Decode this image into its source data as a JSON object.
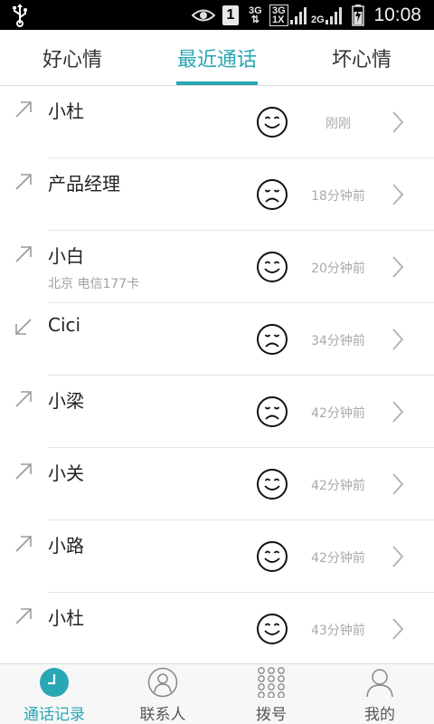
{
  "status_bar": {
    "network_a": "3G",
    "network_b_top": "3G",
    "network_b_bottom": "1X",
    "network_c": "2G",
    "sim_number": "1",
    "time": "10:08"
  },
  "tabs": [
    {
      "label": "好心情",
      "active": false
    },
    {
      "label": "最近通话",
      "active": true
    },
    {
      "label": "坏心情",
      "active": false
    }
  ],
  "calls": [
    {
      "name": "小杜",
      "subtitle": "",
      "mood": "happy",
      "direction": "outgoing",
      "time": "刚刚"
    },
    {
      "name": "产品经理",
      "subtitle": "",
      "mood": "sad",
      "direction": "outgoing",
      "time": "18分钟前"
    },
    {
      "name": "小白",
      "subtitle": "北京  电信177卡",
      "mood": "happy",
      "direction": "outgoing",
      "time": "20分钟前"
    },
    {
      "name": "Cici",
      "subtitle": "",
      "mood": "sad",
      "direction": "incoming",
      "time": "34分钟前"
    },
    {
      "name": "小梁",
      "subtitle": "",
      "mood": "sad",
      "direction": "outgoing",
      "time": "42分钟前"
    },
    {
      "name": "小关",
      "subtitle": "",
      "mood": "happy",
      "direction": "outgoing",
      "time": "42分钟前"
    },
    {
      "name": "小路",
      "subtitle": "",
      "mood": "happy",
      "direction": "outgoing",
      "time": "42分钟前"
    },
    {
      "name": "小杜",
      "subtitle": "",
      "mood": "happy",
      "direction": "outgoing",
      "time": "43分钟前"
    }
  ],
  "bottom_nav": [
    {
      "label": "通话记录",
      "icon": "clock-icon",
      "active": true
    },
    {
      "label": "联系人",
      "icon": "contacts-icon",
      "active": false
    },
    {
      "label": "拨号",
      "icon": "dialpad-icon",
      "active": false
    },
    {
      "label": "我的",
      "icon": "profile-icon",
      "active": false
    }
  ],
  "colors": {
    "accent": "#2aa7b5",
    "text": "#222222",
    "muted": "#aaaaaa"
  }
}
